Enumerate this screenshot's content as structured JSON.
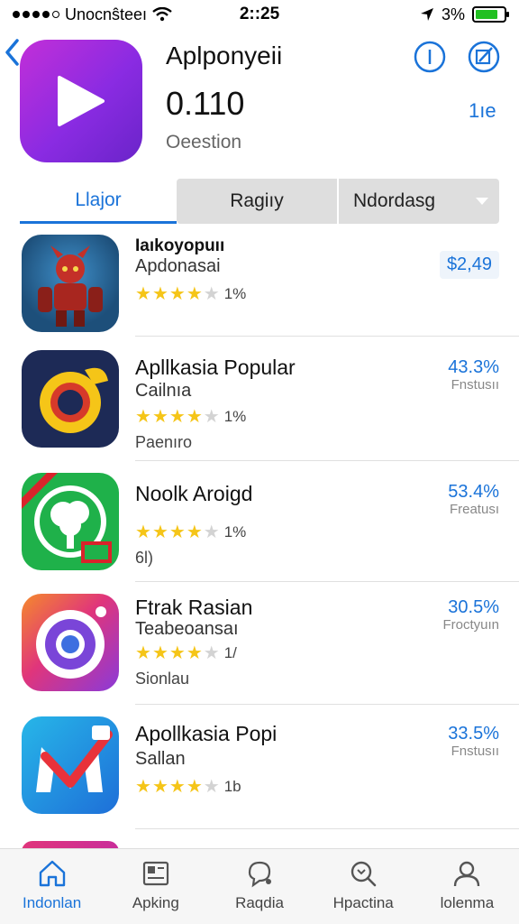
{
  "status_bar": {
    "carrier": "Unocnŝteeı",
    "time": "2::25",
    "battery": "3%",
    "battery_level": 0.8
  },
  "header": {
    "app_title": "Aplponyeii",
    "price": "0.110",
    "subtitle": "Oeestion",
    "link": "1ıe",
    "icons": [
      "back-chevron-icon",
      "play-icon",
      "info-icon",
      "edit-icon"
    ]
  },
  "tabs": [
    {
      "label": "Llajor",
      "active": true
    },
    {
      "label": "Ragiıy",
      "active": false
    },
    {
      "label": "Ndordasg",
      "active": false
    }
  ],
  "apps": [
    {
      "title": "Iaıkoyopuıı",
      "subtitle": "Apdonasai",
      "rating": 4,
      "count": "1%",
      "extra": "",
      "price": "$2,49",
      "price_label": "",
      "icon": "robot-game-icon"
    },
    {
      "title": "Apllkasia Popular",
      "subtitle": "Cailnıa",
      "rating": 4,
      "count": "1%",
      "extra": "Paenıro",
      "price": "43.3%",
      "price_label": "Fnstusıı",
      "icon": "ring-logo-icon"
    },
    {
      "title": "Noolk Aroigd",
      "subtitle": "",
      "rating": 4,
      "count": "1%",
      "extra": "6l)",
      "price": "53.4%",
      "price_label": "Freatusı",
      "icon": "tree-logo-icon"
    },
    {
      "title": "Ftrak Rasian",
      "subtitle": "Teabeoansaı",
      "rating": 4,
      "count": "1/",
      "extra": "Sionlau",
      "price": "30.5%",
      "price_label": "Froctyuın",
      "icon": "camera-lens-icon"
    },
    {
      "title": "Apollkasia Popi",
      "subtitle": "Sallan",
      "rating": 4,
      "count": "1b",
      "extra": "",
      "price": "33.5%",
      "price_label": "Fnstusıı",
      "icon": "mail-m-icon"
    }
  ],
  "nav": [
    {
      "label": "Indonlan",
      "icon": "home-icon",
      "active": true
    },
    {
      "label": "Apking",
      "icon": "apps-icon",
      "active": false
    },
    {
      "label": "Raqdia",
      "icon": "chat-bubble-icon",
      "active": false
    },
    {
      "label": "Hpactina",
      "icon": "search-icon",
      "active": false
    },
    {
      "label": "lolenma",
      "icon": "person-icon",
      "active": false
    }
  ],
  "colors": {
    "accent": "#1a73d9",
    "star": "#f5c518",
    "hero_icon_gradient": [
      "#c22fd8",
      "#6a24c9"
    ]
  }
}
